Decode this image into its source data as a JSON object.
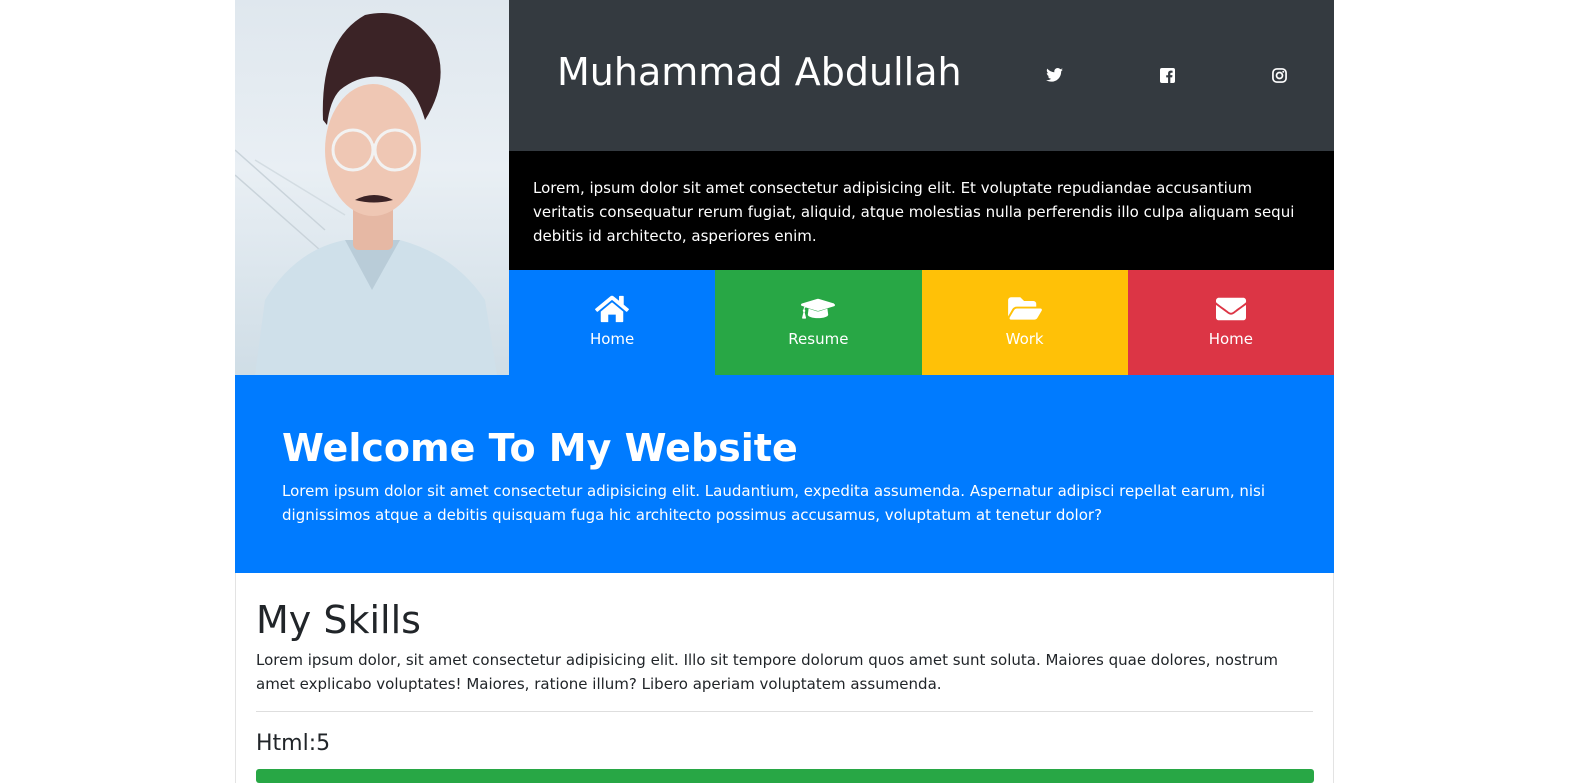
{
  "header": {
    "name": "Muhammad Abdullah",
    "social": [
      {
        "icon": "twitter-icon"
      },
      {
        "icon": "facebook-icon"
      },
      {
        "icon": "instagram-icon"
      }
    ]
  },
  "intro": {
    "text": "Lorem, ipsum dolor sit amet consectetur adipisicing elit. Et voluptate repudiandae accusantium veritatis consequatur rerum fugiat, aliquid, atque molestias nulla perferendis illo culpa aliquam sequi debitis id architecto, asperiores enim."
  },
  "nav": [
    {
      "label": "Home",
      "icon": "home-icon",
      "color": "#007bff"
    },
    {
      "label": "Resume",
      "icon": "graduation-cap-icon",
      "color": "#28a745"
    },
    {
      "label": "Work",
      "icon": "folder-open-icon",
      "color": "#ffc107"
    },
    {
      "label": "Home",
      "icon": "envelope-icon",
      "color": "#dc3545"
    }
  ],
  "welcome": {
    "title": "Welcome To My Website",
    "text": "Lorem ipsum dolor sit amet consectetur adipisicing elit. Laudantium, expedita assumenda. Aspernatur adipisci repellat earum, nisi dignissimos atque a debitis quisquam fuga hic architecto possimus accusamus, voluptatum at tenetur dolor?"
  },
  "skills": {
    "title": "My Skills",
    "text": "Lorem ipsum dolor, sit amet consectetur adipisicing elit. Illo sit tempore dolorum quos amet sunt soluta. Maiores quae dolores, nostrum amet explicabo voluptates! Maiores, ratione illum? Libero aperiam voluptatem assumenda.",
    "items": [
      {
        "label": "Html:5",
        "progress_percent": 100,
        "color": "#28a745"
      }
    ]
  },
  "colors": {
    "dark": "#343a40",
    "black": "#000000",
    "primary": "#007bff",
    "success": "#28a745",
    "warning": "#ffc107",
    "danger": "#dc3545"
  }
}
